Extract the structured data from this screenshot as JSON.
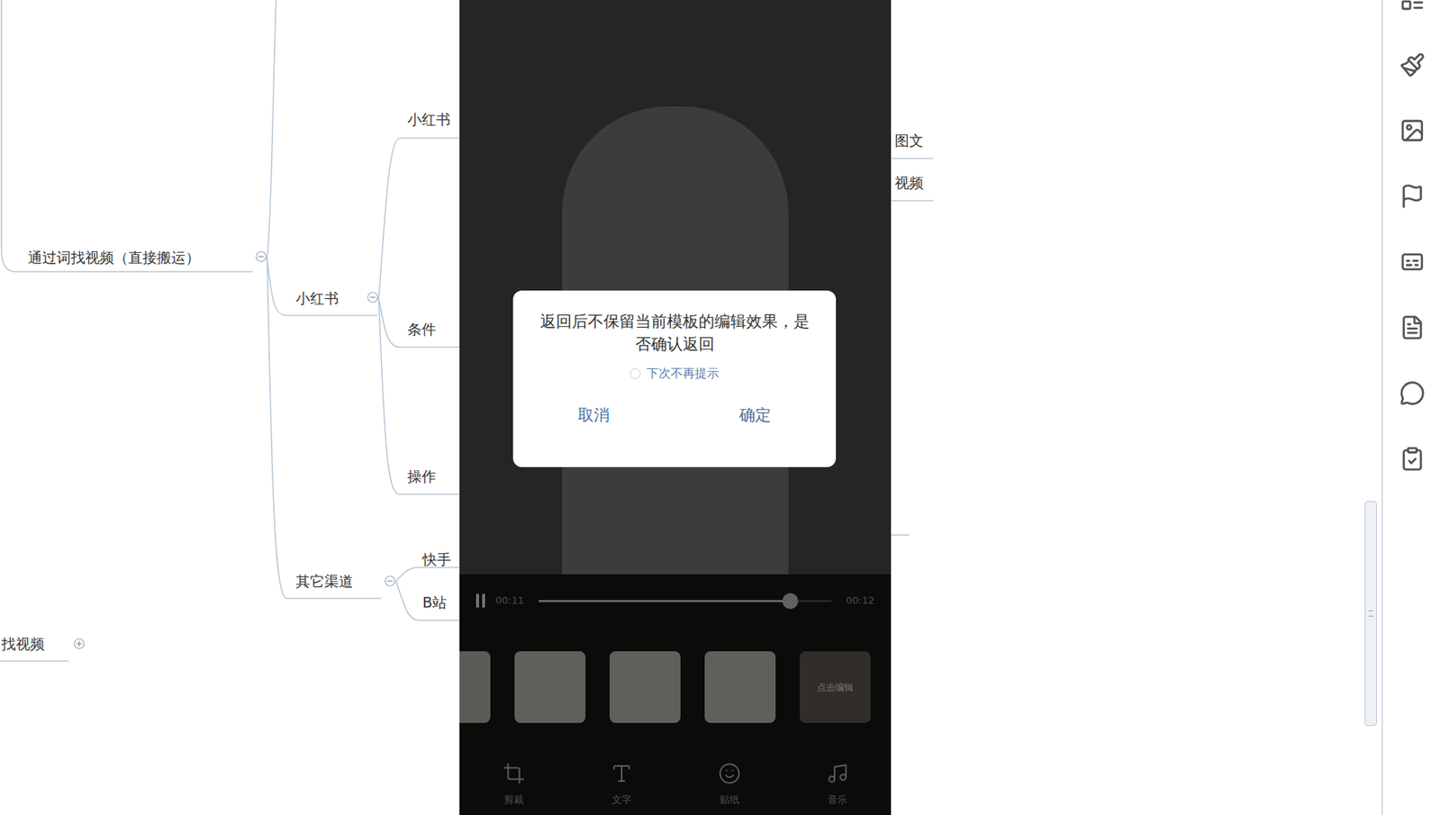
{
  "mindmap": {
    "nodes": [
      {
        "label": "通过词找视频（直接搬运）",
        "expanded": true
      },
      {
        "label": "小红书",
        "expanded": true
      },
      {
        "label": "其它渠道",
        "expanded": true
      },
      {
        "label": "找视频",
        "expanded": false
      }
    ],
    "leaves": [
      {
        "label": "小红书"
      },
      {
        "label": "条件"
      },
      {
        "label": "操作"
      },
      {
        "label": "快手"
      },
      {
        "label": "B站"
      },
      {
        "label": "图文"
      },
      {
        "label": "视频"
      }
    ]
  },
  "player": {
    "playing": true,
    "current": "00:11",
    "total": "00:12",
    "level": 0.86
  },
  "thumbnails": [
    {
      "kind": "partial"
    },
    {
      "kind": "frame"
    },
    {
      "kind": "frame"
    },
    {
      "kind": "frame"
    },
    {
      "kind": "edit",
      "label": "点击编辑"
    }
  ],
  "tools": [
    {
      "label": "剪裁"
    },
    {
      "label": "文字"
    },
    {
      "label": "贴纸"
    },
    {
      "label": "音乐"
    }
  ],
  "dialog": {
    "message": "返回后不保留当前模板的编辑效果，是否确认返回",
    "checkbox": {
      "label": "下次不再提示",
      "checked": false
    },
    "buttons": [
      {
        "label": "取消"
      },
      {
        "label": "确定"
      }
    ]
  }
}
